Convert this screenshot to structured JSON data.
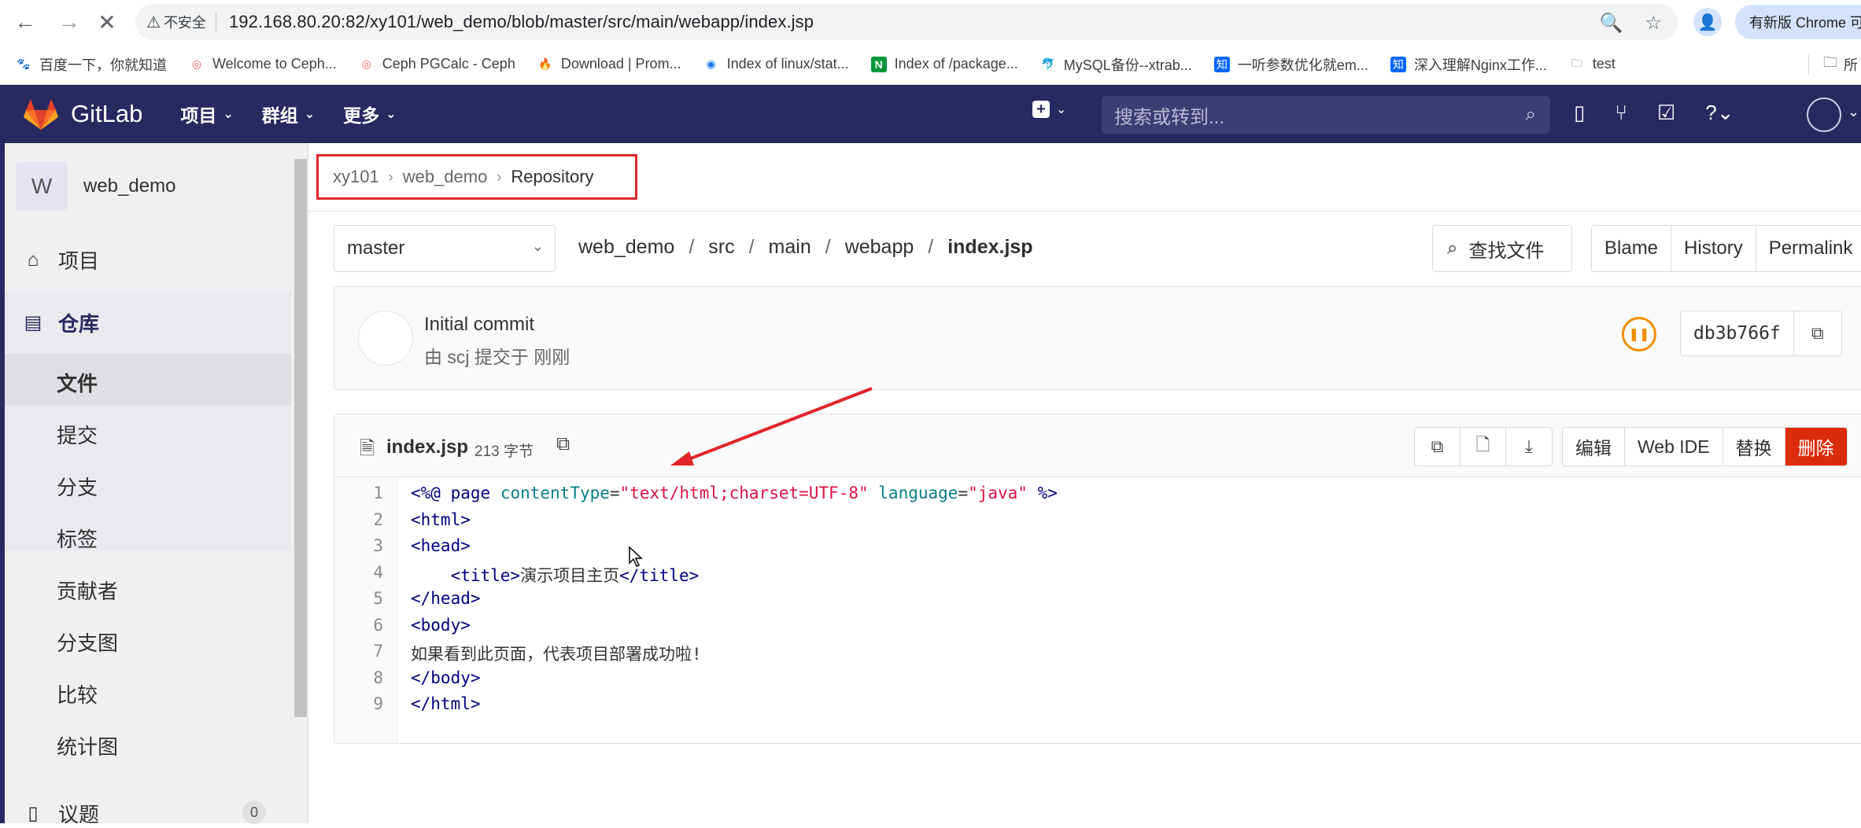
{
  "browser": {
    "security_label": "不安全",
    "url_host": "192.168.80.20",
    "url_rest": ":82/xy101/web_demo/blob/master/src/main/webapp/index.jsp",
    "update_label": "有新版 Chrome 可用",
    "bookmarks": [
      {
        "label": "百度一下，你就知道",
        "icon": "baidu-icon",
        "color": "#2932e1"
      },
      {
        "label": "Welcome to Ceph...",
        "icon": "ceph-icon",
        "color": "#ef5c55"
      },
      {
        "label": "Ceph PGCalc - Ceph",
        "icon": "ceph-icon",
        "color": "#ef5c55"
      },
      {
        "label": "Download | Prom...",
        "icon": "prometheus-icon",
        "color": "#e6522c"
      },
      {
        "label": "Index of linux/stat...",
        "icon": "globe-icon",
        "color": "#1a73e8"
      },
      {
        "label": "Index of /package...",
        "icon": "nginx-icon",
        "color": "#009639"
      },
      {
        "label": "MySQL备份--xtrab...",
        "icon": "mysql-icon",
        "color": "#333333"
      },
      {
        "label": "一听参数优化就em...",
        "icon": "zhihu-icon",
        "color": "#0066ff"
      },
      {
        "label": "深入理解Nginx工作...",
        "icon": "zhihu-icon",
        "color": "#0066ff"
      },
      {
        "label": "test",
        "icon": "folder-icon",
        "color": "#5f6368"
      }
    ],
    "bookmarks_overflow": "所"
  },
  "gitlab": {
    "brand": "GitLab",
    "menu": [
      "项目",
      "群组",
      "更多"
    ],
    "search_placeholder": "搜索或转到..."
  },
  "sidebar": {
    "project_initial": "W",
    "project_name": "web_demo",
    "items": {
      "project": "项目",
      "repository": "仓库",
      "issues": "议题",
      "issues_count": "0"
    },
    "sub_items": [
      "文件",
      "提交",
      "分支",
      "标签",
      "贡献者",
      "分支图",
      "比较",
      "统计图"
    ]
  },
  "breadcrumb": [
    "xy101",
    "web_demo",
    "Repository"
  ],
  "repo": {
    "branch": "master",
    "path": [
      "web_demo",
      "src",
      "main",
      "webapp"
    ],
    "file": "index.jsp",
    "find_file": "查找文件",
    "view_buttons": [
      "Blame",
      "History",
      "Permalink"
    ]
  },
  "commit": {
    "title": "Initial commit",
    "meta": "由 scj 提交于 刚刚",
    "sha": "db3b766f"
  },
  "file": {
    "name": "index.jsp",
    "size": "213 字节",
    "actions": [
      "编辑",
      "Web IDE",
      "替换",
      "删除"
    ],
    "line_numbers": [
      "1",
      "2",
      "3",
      "4",
      "5",
      "6",
      "7",
      "8",
      "9"
    ],
    "lines": [
      "<%@ page contentType=\"text/html;charset=UTF-8\" language=\"java\" %>",
      "<html>",
      "<head>",
      "    <title>演示项目主页</title>",
      "</head>",
      "<body>",
      "如果看到此页面，代表项目部署成功啦!",
      "</body>",
      "</html>"
    ]
  },
  "colors": {
    "gitlab_nav": "#292961",
    "annotation_red": "#e0252a",
    "danger": "#dd2b0e",
    "pipeline_running": "#ef8e00"
  }
}
